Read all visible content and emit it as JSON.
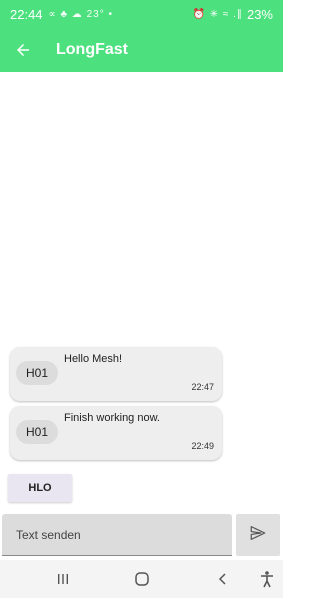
{
  "status_bar": {
    "time": "22:44",
    "left_icons": "∝ ♣ ☁ 23° •",
    "right_icons": "⏰ ✳ ≈ .∥",
    "battery": "23%"
  },
  "app_bar": {
    "title": "LongFast"
  },
  "messages": [
    {
      "sender": "H01",
      "text": "Hello Mesh!",
      "time": "22:47"
    },
    {
      "sender": "H01",
      "text": "Finish working now.",
      "time": "22:49"
    }
  ],
  "quick_reply": "HLO",
  "composer": {
    "placeholder": "Text senden"
  },
  "colors": {
    "primary": "#4ce07e",
    "bubble": "#eeeeee",
    "sender_chip": "#dcdcdc",
    "quick_chip": "#e9e5f1"
  },
  "icons": {
    "back": "arrow-left-icon",
    "send": "send-icon",
    "nav_recent": "recent-apps-icon",
    "nav_home": "home-icon",
    "nav_back": "nav-back-icon",
    "nav_accessibility": "accessibility-icon"
  }
}
